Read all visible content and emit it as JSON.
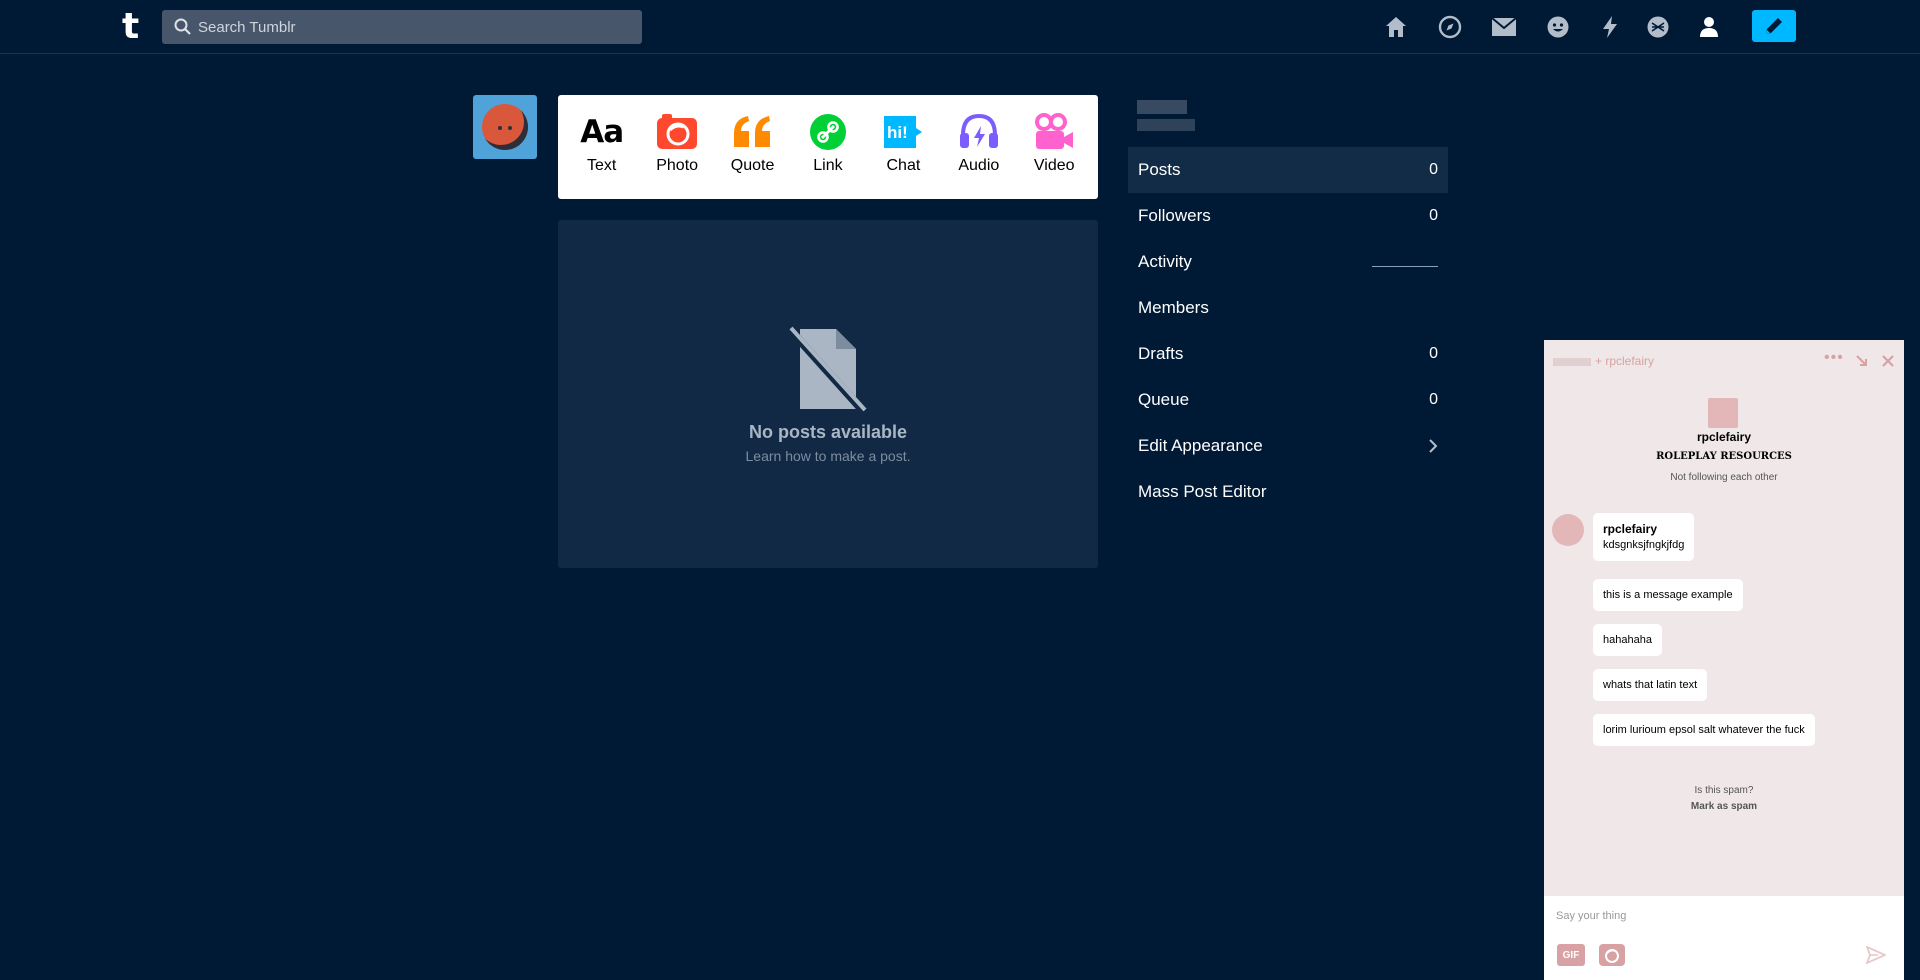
{
  "app": {
    "logo": "t"
  },
  "search": {
    "placeholder": "Search Tumblr"
  },
  "nav": {
    "icons": [
      "home-icon",
      "explore-icon",
      "inbox-icon",
      "messages-icon",
      "activity-icon",
      "mobile-icon",
      "account-icon"
    ],
    "compose_icon": "pencil-icon",
    "accent": "#00b8ff"
  },
  "post_types": [
    {
      "label": "Text",
      "icon": "text-icon",
      "color": "#000000"
    },
    {
      "label": "Photo",
      "icon": "photo-icon",
      "color": "#ff492f"
    },
    {
      "label": "Quote",
      "icon": "quote-icon",
      "color": "#ff8a00"
    },
    {
      "label": "Link",
      "icon": "link-icon",
      "color": "#00cf35"
    },
    {
      "label": "Chat",
      "icon": "chat-icon",
      "color": "#00b8ff"
    },
    {
      "label": "Audio",
      "icon": "audio-icon",
      "color": "#7c5cff"
    },
    {
      "label": "Video",
      "icon": "video-icon",
      "color": "#ff62ce"
    }
  ],
  "empty": {
    "title": "No posts available",
    "subtitle": "Learn how to make a post."
  },
  "sidebar": {
    "items": [
      {
        "label": "Posts",
        "count": "0"
      },
      {
        "label": "Followers",
        "count": "0"
      },
      {
        "label": "Activity",
        "count": ""
      },
      {
        "label": "Members",
        "count": ""
      },
      {
        "label": "Drafts",
        "count": "0"
      },
      {
        "label": "Queue",
        "count": "0"
      },
      {
        "label": "Edit Appearance",
        "count": ""
      },
      {
        "label": "Mass Post Editor",
        "count": ""
      }
    ]
  },
  "messaging": {
    "header_title": "+ rpclefairy",
    "name": "rpclefairy",
    "blog_title": "ROLEPLAY RESOURCES",
    "status": "Not following each other",
    "sender": "rpclefairy",
    "messages": [
      "kdsgnksjfngkjfdg",
      "this is a message example",
      "hahahaha",
      "whats that latin text",
      "lorim lurioum epsol salt whatever the fuck"
    ],
    "spam_question": "Is this spam?",
    "spam_link": "Mark as spam",
    "input_placeholder": "Say your thing",
    "gif_label": "GIF",
    "accent": "#d8a1a3"
  }
}
